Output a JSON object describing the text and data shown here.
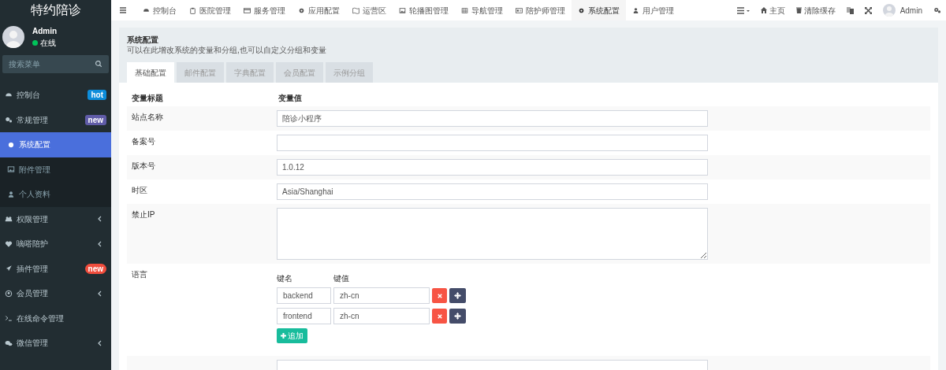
{
  "logo": "特约陪诊",
  "user": {
    "name": "Admin",
    "status": "在线",
    "online": true
  },
  "search": {
    "placeholder": "搜索菜单"
  },
  "sidebar": {
    "items": [
      {
        "label": "控制台",
        "badge": {
          "text": "hot",
          "color": "#0d8ddb"
        },
        "selected": false,
        "sub": false,
        "caret": false
      },
      {
        "label": "常规管理",
        "badge": {
          "text": "new",
          "color": "#605ca8"
        },
        "selected": false,
        "sub": false,
        "caret": false
      },
      {
        "label": "系统配置",
        "selected": true,
        "sub": true,
        "caret": false
      },
      {
        "label": "附件管理",
        "selected": false,
        "sub": true,
        "caret": false
      },
      {
        "label": "个人资料",
        "selected": false,
        "sub": true,
        "caret": false
      },
      {
        "label": "权限管理",
        "selected": false,
        "sub": false,
        "caret": true
      },
      {
        "label": "嘀嗒陪护",
        "selected": false,
        "sub": false,
        "caret": true
      },
      {
        "label": "插件管理",
        "badge": {
          "text": "new",
          "color": "#f14d3d"
        },
        "selected": false,
        "sub": false,
        "caret": false
      },
      {
        "label": "会员管理",
        "selected": false,
        "sub": false,
        "caret": true
      },
      {
        "label": "在线命令管理",
        "selected": false,
        "sub": false,
        "caret": false
      },
      {
        "label": "微信管理",
        "selected": false,
        "sub": false,
        "caret": true
      }
    ]
  },
  "topnav": {
    "tabs": [
      {
        "label": "控制台",
        "selected": false
      },
      {
        "label": "医院管理",
        "selected": false
      },
      {
        "label": "服务管理",
        "selected": false
      },
      {
        "label": "应用配置",
        "selected": false
      },
      {
        "label": "运营区",
        "selected": false
      },
      {
        "label": "轮播图管理",
        "selected": false
      },
      {
        "label": "导航管理",
        "selected": false
      },
      {
        "label": "陪护师管理",
        "selected": false
      },
      {
        "label": "系统配置",
        "selected": true
      },
      {
        "label": "用户管理",
        "selected": false
      }
    ],
    "home": "主页",
    "clear_cache": "清除缓存",
    "admin": "Admin"
  },
  "page": {
    "title": "系统配置",
    "description": "可以在此增改系统的变量和分组,也可以自定义分组和变量",
    "tabs": [
      {
        "label": "基础配置",
        "selected": true
      },
      {
        "label": "邮件配置",
        "selected": false
      },
      {
        "label": "字典配置",
        "selected": false
      },
      {
        "label": "会员配置",
        "selected": false
      },
      {
        "label": "示例分组",
        "selected": false
      }
    ],
    "columns": [
      "变量标题",
      "变量值"
    ],
    "rows": [
      {
        "kind": "text",
        "label": "站点名称",
        "value": "陪诊小程序"
      },
      {
        "kind": "text",
        "label": "备案号"
      },
      {
        "kind": "text",
        "label": "版本号",
        "value": "1.0.12"
      },
      {
        "kind": "text",
        "label": "时区",
        "value": "Asia/Shanghai"
      },
      {
        "kind": "textarea",
        "label": "禁止IP"
      },
      {
        "kind": "keyvalue",
        "label": "语言",
        "key_header": "键名",
        "value_header": "键值",
        "pairs": [
          {
            "key": "backend",
            "value": "zh-cn"
          },
          {
            "key": "frontend",
            "value": "zh-cn"
          }
        ],
        "add": "追加"
      },
      {
        "kind": "text"
      }
    ]
  }
}
